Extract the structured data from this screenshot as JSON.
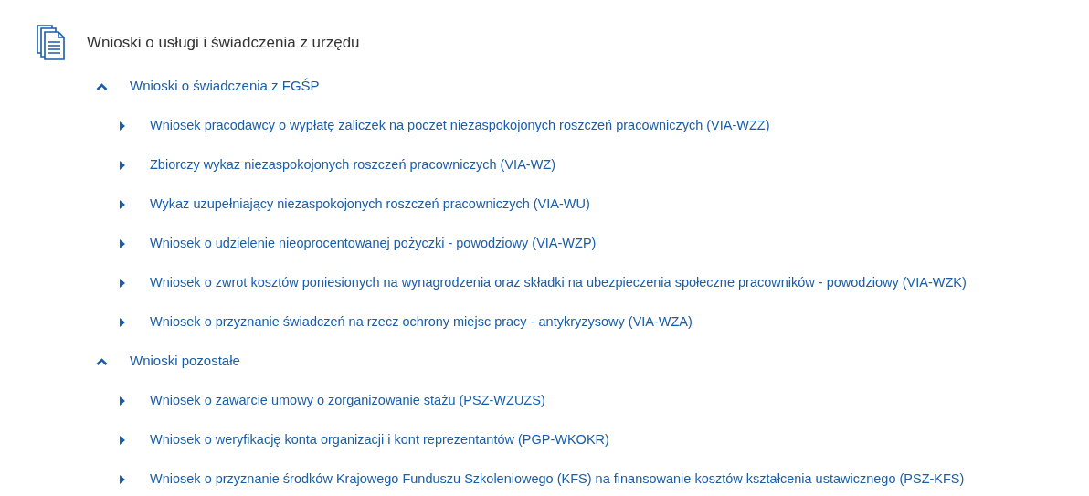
{
  "title": "Wnioski o usługi i świadczenia z urzędu",
  "groups": [
    {
      "label": "Wnioski o świadczenia z FGŚP",
      "expanded": true,
      "children": [
        {
          "label": "Wniosek pracodawcy o wypłatę zaliczek na poczet niezaspokojonych roszczeń pracowniczych (VIA-WZZ)",
          "expanded": false
        },
        {
          "label": "Zbiorczy wykaz niezaspokojonych roszczeń pracowniczych (VIA-WZ)",
          "expanded": false
        },
        {
          "label": "Wykaz uzupełniający niezaspokojonych roszczeń pracowniczych (VIA-WU)",
          "expanded": false
        },
        {
          "label": "Wniosek o udzielenie nieoprocentowanej pożyczki - powodziowy (VIA-WZP)",
          "expanded": false
        },
        {
          "label": "Wniosek o zwrot kosztów poniesionych na wynagrodzenia oraz składki na ubezpieczenia społeczne pracowników - powodziowy (VIA-WZK)",
          "expanded": false
        },
        {
          "label": "Wniosek o przyznanie świadczeń na rzecz ochrony miejsc pracy - antykryzysowy (VIA-WZA)",
          "expanded": false
        }
      ]
    },
    {
      "label": "Wnioski pozostałe",
      "expanded": true,
      "children": [
        {
          "label": "Wniosek o zawarcie umowy o zorganizowanie stażu (PSZ-WZUZS)",
          "expanded": false
        },
        {
          "label": "Wniosek o weryfikację konta organizacji i kont reprezentantów (PGP-WKOKR)",
          "expanded": false
        },
        {
          "label": "Wniosek o przyznanie środków Krajowego Funduszu Szkoleniowego (KFS) na finansowanie kosztów kształcenia ustawicznego (PSZ-KFS)",
          "expanded": false
        }
      ]
    }
  ]
}
